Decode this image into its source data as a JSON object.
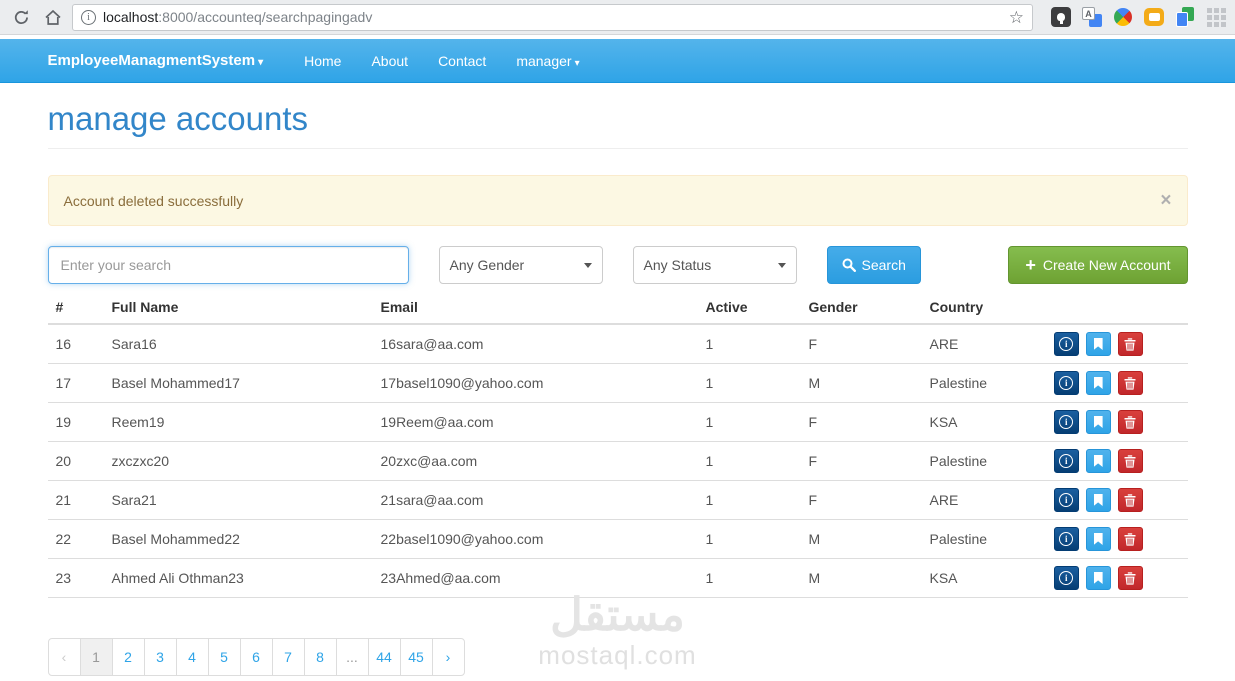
{
  "browser": {
    "url_host": "localhost",
    "url_rest": ":8000/accounteq/searchpagingadv",
    "bookmark_star": "☆",
    "page_info": "i"
  },
  "navbar": {
    "brand": "EmployeeManagmentSystem",
    "items": [
      {
        "label": "Home"
      },
      {
        "label": "About"
      },
      {
        "label": "Contact"
      },
      {
        "label": "manager"
      }
    ],
    "caret": "▾"
  },
  "page": {
    "title": "manage accounts"
  },
  "alert": {
    "message": "Account deleted successfully",
    "close_label": "×"
  },
  "controls": {
    "search_placeholder": "Enter your search",
    "gender_selected": "Any Gender",
    "status_selected": "Any Status",
    "search_label": "Search",
    "create_plus": "+",
    "create_label": "Create New Account"
  },
  "table": {
    "headers": {
      "id": "#",
      "name": "Full Name",
      "email": "Email",
      "active": "Active",
      "gender": "Gender",
      "country": "Country"
    },
    "rows": [
      {
        "id": "16",
        "name": "Sara16",
        "email": "16sara@aa.com",
        "active": "1",
        "gender": "F",
        "country": "ARE"
      },
      {
        "id": "17",
        "name": "Basel Mohammed17",
        "email": "17basel1090@yahoo.com",
        "active": "1",
        "gender": "M",
        "country": "Palestine"
      },
      {
        "id": "19",
        "name": "Reem19",
        "email": "19Reem@aa.com",
        "active": "1",
        "gender": "F",
        "country": "KSA"
      },
      {
        "id": "20",
        "name": "zxczxc20",
        "email": "20zxc@aa.com",
        "active": "1",
        "gender": "F",
        "country": "Palestine"
      },
      {
        "id": "21",
        "name": "Sara21",
        "email": "21sara@aa.com",
        "active": "1",
        "gender": "F",
        "country": "ARE"
      },
      {
        "id": "22",
        "name": "Basel Mohammed22",
        "email": "22basel1090@yahoo.com",
        "active": "1",
        "gender": "M",
        "country": "Palestine"
      },
      {
        "id": "23",
        "name": "Ahmed Ali Othman23",
        "email": "23Ahmed@aa.com",
        "active": "1",
        "gender": "M",
        "country": "KSA"
      }
    ]
  },
  "pagination": {
    "prev": "‹",
    "pages": [
      "1",
      "2",
      "3",
      "4",
      "5",
      "6",
      "7",
      "8",
      "...",
      "44",
      "45"
    ],
    "ellipsis": "...",
    "active": "1",
    "next": "›"
  },
  "watermark": {
    "arabic": "مستقل",
    "latin": "mostaql.com"
  },
  "colors": {
    "navbar_top": "#54b4eb",
    "navbar_bottom": "#2fa4e7",
    "heading": "#3286c9",
    "primary": "#2fa4e7",
    "success": "#73a839",
    "info": "#033c73",
    "danger": "#c71c22",
    "alert_bg": "#fcf8e3",
    "alert_text": "#8a6d3b"
  }
}
